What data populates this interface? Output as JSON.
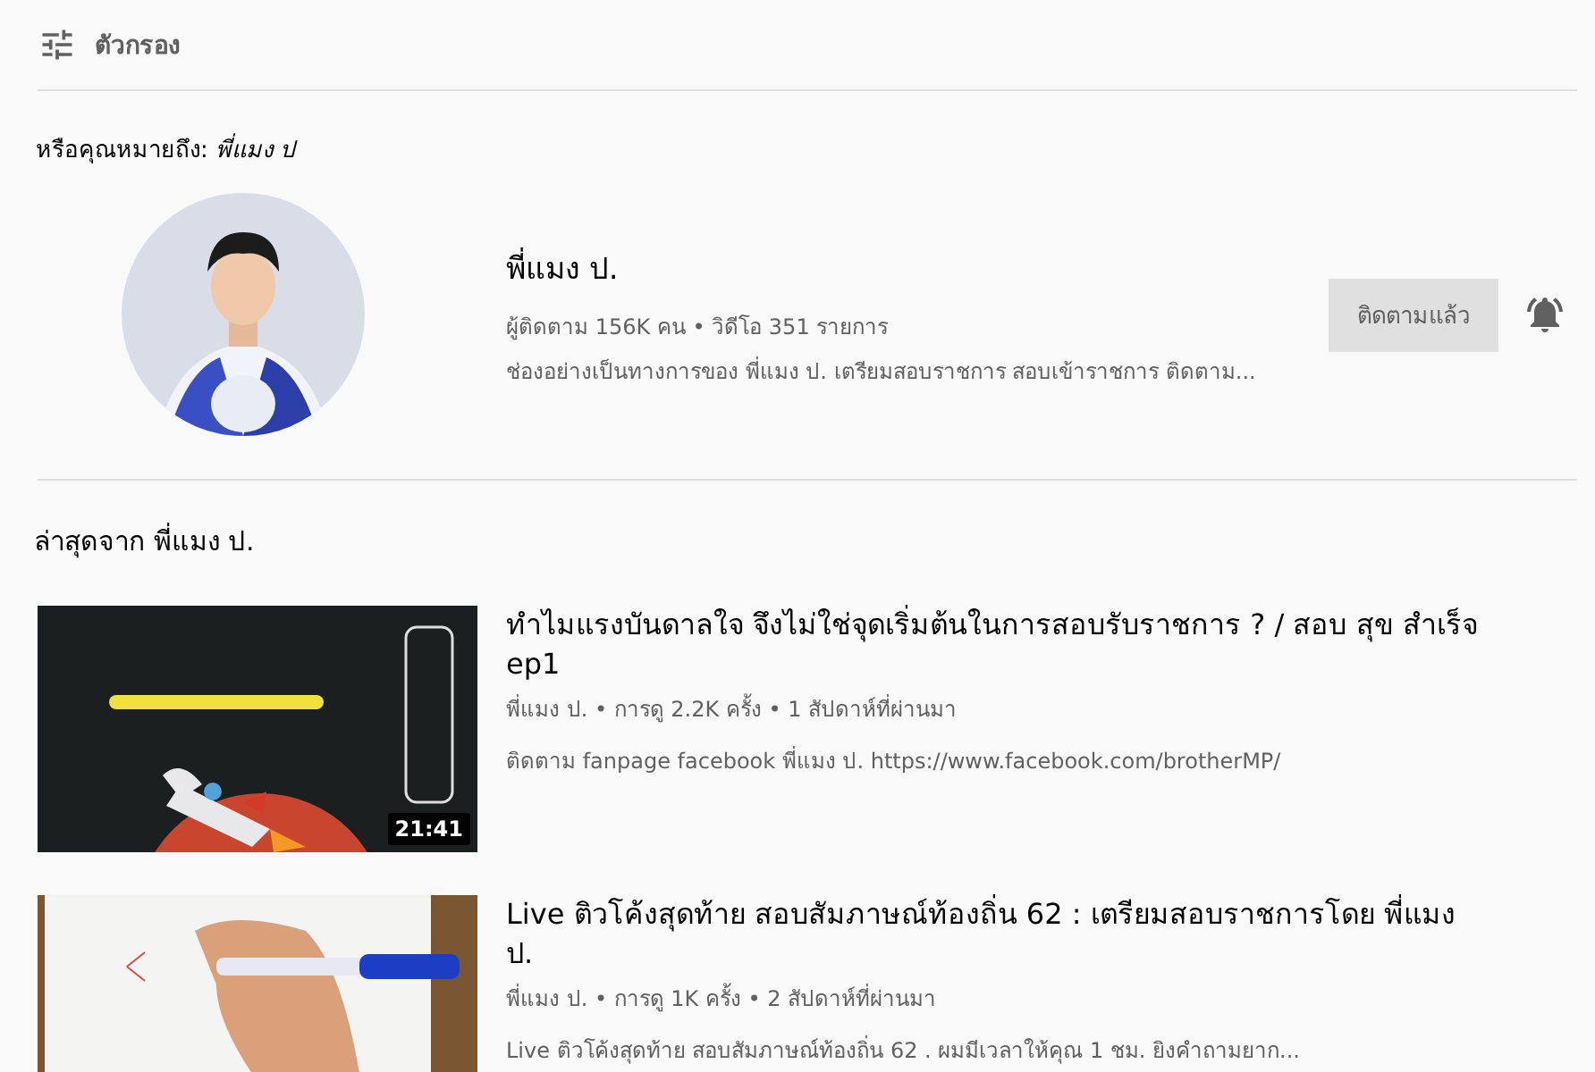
{
  "filter": {
    "label": "ตัวกรอง"
  },
  "suggestion": {
    "text": "หรือคุณหมายถึง: *พี่แมง ป*"
  },
  "channel": {
    "name": "พี่แมง ป.",
    "stats": "ผู้ติดตาม 156K คน • วิดีโอ 351 รายการ",
    "description": "ช่องอย่างเป็นทางการของ พี่แมง ป. เตรียมสอบราชการ สอบเข้าราชการ ติดตาม...",
    "subscribe_label": "ติดตามแล้ว",
    "subscribed": true
  },
  "section": {
    "title": "ล่าสุดจาก พี่แมง ป."
  },
  "videos": [
    {
      "title": "ทำไมแรงบันดาลใจ จึงไม่ใช่จุดเริ่มต้นในการสอบรับราชการ ? / สอบ สุข สำเร็จ ep1",
      "meta": "พี่แมง ป. • การดู 2.2K ครั้ง • 1 สัปดาห์ที่ผ่านมา",
      "description": "ติดตาม fanpage facebook พี่แมง ป. https://www.facebook.com/brotherMP/",
      "duration": "21:41"
    },
    {
      "title": "Live ติวโค้งสุดท้าย สอบสัมภาษณ์ท้องถิ่น 62 : เตรียมสอบราชการโดย พี่แมง ป.",
      "meta": "พี่แมง ป. • การดู 1K ครั้ง • 2 สัปดาห์ที่ผ่านมา",
      "description": "Live ติวโค้งสุดท้าย สอบสัมภาษณ์ท้องถิ่น 62 . ผมมีเวลาให้คุณ 1 ชม. ยิงคำถามยาก..."
    }
  ]
}
